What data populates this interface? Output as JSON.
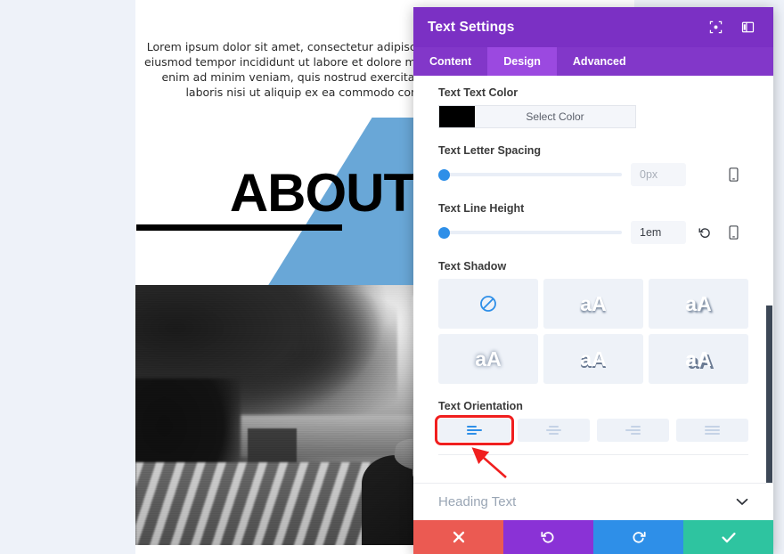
{
  "page": {
    "lorem_text": "Lorem ipsum dolor sit amet, consectetur adipiscing elit, sed do eiusmod tempor incididunt ut labore et dolore magna aliqua. Ut enim ad minim veniam, quis nostrud exercitation ullamco laboris nisi ut aliquip ex ea commodo consequat.",
    "about_heading": "ABOUT",
    "shape_color": "#69a7d7",
    "photo_alt": "grayscale photo of a man sitting outdoors on a bench"
  },
  "modal": {
    "title": "Text Settings",
    "header_icons": [
      {
        "name": "focus-target-icon"
      },
      {
        "name": "panel-layout-icon"
      }
    ],
    "accent_color": "#7b30c4",
    "tabs": [
      {
        "label": "Content",
        "active": false
      },
      {
        "label": "Design",
        "active": true
      },
      {
        "label": "Advanced",
        "active": false
      }
    ],
    "fields": {
      "text_color": {
        "label": "Text Text Color",
        "swatch_hex": "#000000",
        "button_label": "Select Color"
      },
      "letter_spacing": {
        "label": "Text Letter Spacing",
        "value": "0px",
        "is_placeholder": true,
        "slider_percent": 0
      },
      "line_height": {
        "label": "Text Line Height",
        "value": "1em",
        "is_placeholder": false,
        "slider_percent": 0
      },
      "text_shadow": {
        "label": "Text Shadow",
        "options": [
          {
            "name": "shadow-none",
            "glyph": "⃠"
          },
          {
            "name": "shadow-soft-bottom",
            "glyph": "aA"
          },
          {
            "name": "shadow-soft-diagonal",
            "glyph": "aA"
          },
          {
            "name": "shadow-glow",
            "glyph": "aA"
          },
          {
            "name": "shadow-hard-bottom",
            "glyph": "aA"
          },
          {
            "name": "shadow-hard-diagonal",
            "glyph": "aA"
          }
        ]
      },
      "text_orientation": {
        "label": "Text Orientation",
        "options": [
          {
            "name": "align-left",
            "active": true,
            "highlighted": true
          },
          {
            "name": "align-center",
            "active": false,
            "highlighted": false
          },
          {
            "name": "align-right",
            "active": false,
            "highlighted": false
          },
          {
            "name": "align-justify",
            "active": false,
            "highlighted": false
          }
        ]
      }
    },
    "collapsed_section": {
      "title": "Heading Text",
      "chevron": "⌄"
    },
    "footer_buttons": [
      {
        "name": "cancel-button",
        "glyph": "✖",
        "color": "#eb5a52"
      },
      {
        "name": "undo-button",
        "glyph": "↺",
        "color": "#8a32d6"
      },
      {
        "name": "redo-button",
        "glyph": "↻",
        "color": "#2e8fe8"
      },
      {
        "name": "save-button",
        "glyph": "✔",
        "color": "#2ec4a0"
      }
    ]
  }
}
